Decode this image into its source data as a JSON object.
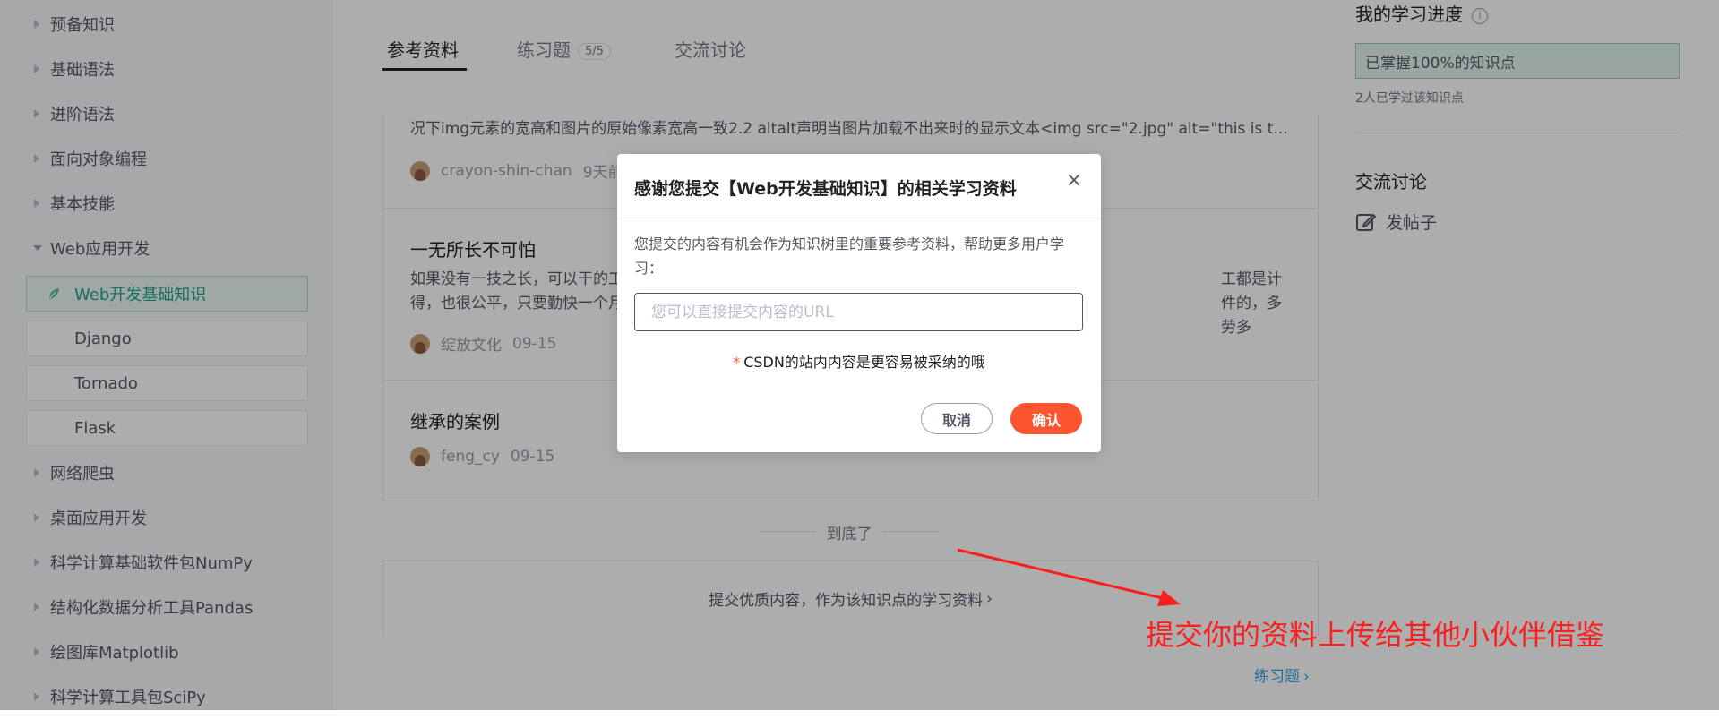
{
  "sidebar": {
    "items": [
      {
        "label": "预备知识"
      },
      {
        "label": "基础语法"
      },
      {
        "label": "进阶语法"
      },
      {
        "label": "面向对象编程"
      },
      {
        "label": "基本技能"
      },
      {
        "label": "Web应用开发"
      },
      {
        "label": "网络爬虫"
      },
      {
        "label": "桌面应用开发"
      },
      {
        "label": "科学计算基础软件包NumPy"
      },
      {
        "label": "结构化数据分析工具Pandas"
      },
      {
        "label": "绘图库Matplotlib"
      },
      {
        "label": "科学计算工具包SciPy"
      }
    ],
    "subitems": [
      {
        "label": "Web开发基础知识"
      },
      {
        "label": "Django"
      },
      {
        "label": "Tornado"
      },
      {
        "label": "Flask"
      }
    ]
  },
  "tabs": [
    {
      "label": "参考资料"
    },
    {
      "label": "练习题",
      "badge": "5/5"
    },
    {
      "label": "交流讨论"
    }
  ],
  "articles": [
    {
      "excerpt": "况下img元素的宽高和图片的原始像素宽高一致2.2 altalt声明当图片加载不出来时的显示文本<img src=\"2.jpg\" alt=\"this is t...",
      "author": "crayon-shin-chan",
      "date": "9天前"
    },
    {
      "title": "一无所长不可怕",
      "excerpt_left": "如果没有一技之长，可以干的工",
      "excerpt_right": "工都是计件的，多劳多",
      "excerpt_line2": "得，也很公平，只要勤快一个月",
      "author": "绽放文化",
      "date": "09-15"
    },
    {
      "title": "继承的案例",
      "author": "feng_cy",
      "date": "09-15"
    }
  ],
  "end_text": "到底了",
  "submit_text": "提交优质内容，作为该知识点的学习资料",
  "practice_link": "练习题",
  "right": {
    "progress_title": "我的学习进度",
    "progress_text": "已掌握100%的知识点",
    "learned_text": "2人已学过该知识点",
    "discuss_title": "交流讨论",
    "post_label": "发帖子"
  },
  "dialog": {
    "title": "感谢您提交【Web开发基础知识】的相关学习资料",
    "description": "您提交的内容有机会作为知识树里的重要参考资料，帮助更多用户学习：",
    "input_placeholder": "您可以直接提交内容的URL",
    "note_star": "*",
    "note": "CSDN的站内内容是更容易被采纳的哦",
    "cancel": "取消",
    "confirm": "确认"
  },
  "annotation": "提交你的资料上传给其他小伙伴借鉴",
  "colors": {
    "accent": "#fc5531",
    "green": "#1fa286",
    "annotation": "#fc1f1f",
    "link": "#349ee6"
  }
}
